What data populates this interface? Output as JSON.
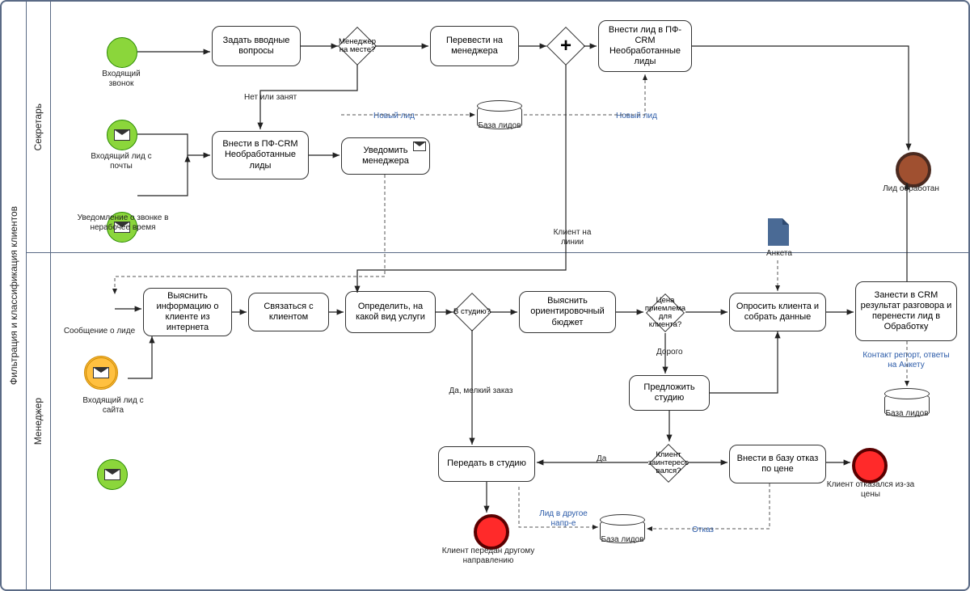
{
  "pool": "Фильтрация и классификация клиентов",
  "lanes": {
    "sec": "Секретарь",
    "mgr": "Менеджер"
  },
  "events": {
    "call_in": "Входящий звонок",
    "mail_lead": "Входящий лид с почты",
    "offhour": "Уведомление о звонке в нерабочее время",
    "lead_msg": "Сообщение о лиде",
    "site_lead": "Входящий лид с сайта",
    "lead_processed": "Лид обработан",
    "client_transferred": "Клиент передан другому направлению",
    "client_refused": "Клиент отказался из-за цены"
  },
  "tasks": {
    "ask_intro": "Задать вводные вопросы",
    "transfer_mgr": "Перевести на менеджера",
    "add_lead_pf": "Внести лид в ПФ-CRM Необработанные лиды",
    "add_pf_crm": "Внести в ПФ-CRM Необработанные лиды",
    "notify_mgr": "Уведомить менеджера",
    "find_info": "Выяснить информацию о клиенте из интернета",
    "contact": "Связаться с клиентом",
    "define": "Определить, на какой вид услуги",
    "budget": "Выяснить ориентировочный бюджет",
    "survey": "Опросить клиента и собрать данные",
    "to_crm": "Занести в CRM результат разговора и перенести лид в Обработку",
    "offer_studio": "Предложить студию",
    "to_studio": "Передать в студию",
    "add_refusal": "Внести в базу отказ по цене"
  },
  "gateways": {
    "mgr_here": "Менеджер на месте?",
    "in_studio": "В студию?",
    "price_ok": "Цена приемлема для клиента?",
    "interested": "Клиент заинтересо вался?",
    "plus": "+"
  },
  "edges": {
    "no_busy": "Нет или занят",
    "new_lead": "Новый лид",
    "client_line": "Клиент на линии",
    "small_order": "Да, мелкий заказ",
    "too_expensive": "Дорого",
    "yes": "Да",
    "other_dir": "Лид в другое напр-е",
    "refusal": "Отказ",
    "contact_report": "Контакт репорт, ответы на Анкету"
  },
  "datastores": {
    "leads": "База лидов"
  },
  "docs": {
    "form": "Анкета"
  }
}
